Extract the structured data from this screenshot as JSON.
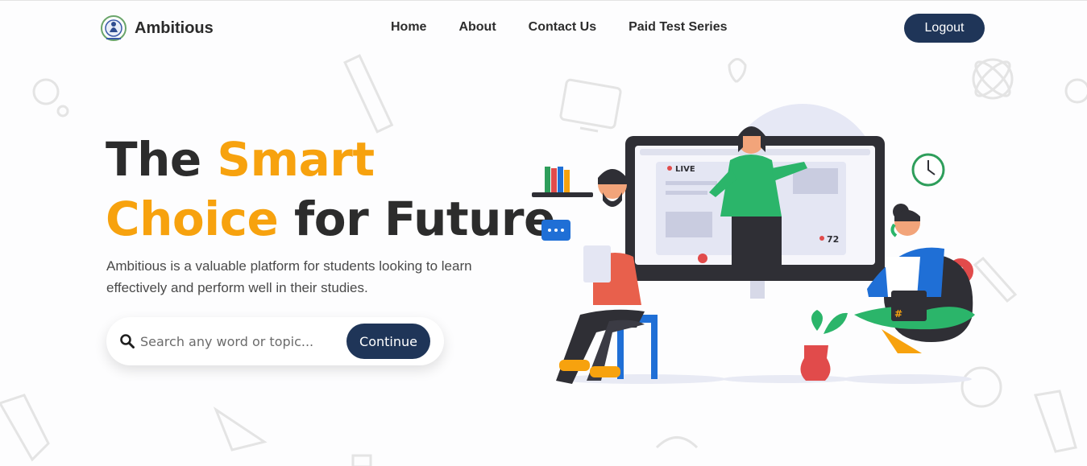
{
  "brand": {
    "name": "Ambitious",
    "logo_icon": "emblem-icon"
  },
  "nav": {
    "links": [
      "Home",
      "About",
      "Contact Us",
      "Paid Test Series"
    ],
    "logout_label": "Logout"
  },
  "hero": {
    "title_part1": "The ",
    "title_accent1": "Smart",
    "title_accent2": "Choice",
    "title_part2": " for Future",
    "description": "Ambitious is a valuable platform for students looking to learn effectively and perform well in their studies."
  },
  "search": {
    "placeholder": "Search any word or topic...",
    "button_label": "Continue"
  },
  "illustration": {
    "live_label": "LIVE",
    "viewer_count": "72"
  },
  "colors": {
    "accent": "#f7a20e",
    "primary_dark": "#1f3558",
    "text_dark": "#2c2c2c"
  }
}
